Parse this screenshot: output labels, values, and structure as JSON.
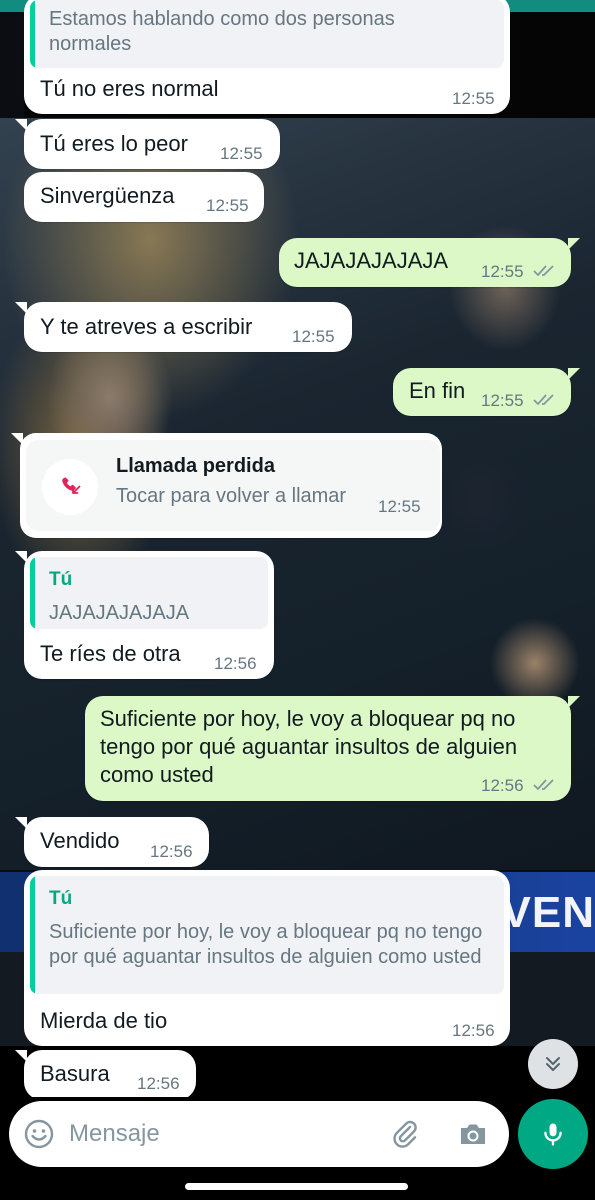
{
  "colors": {
    "incoming_bubble": "#ffffff",
    "outgoing_bubble": "#dcf8c6",
    "accent_green": "#00a884",
    "quote_bar": "#06cf9c",
    "timestamp": "#667781",
    "missed_call_red": "#e0245e"
  },
  "messages": {
    "m1": {
      "quote_text": "Estamos hablando como dos personas normales",
      "text": "Tú no eres normal",
      "time": "12:55"
    },
    "m2": {
      "text": "Tú eres lo peor",
      "time": "12:55"
    },
    "m3": {
      "text": "Sinvergüenza",
      "time": "12:55"
    },
    "m4": {
      "text": "JAJAJAJAJAJA",
      "time": "12:55",
      "read_ticks": "double-tick-icon"
    },
    "m5": {
      "text": "Y te atreves a escribir",
      "time": "12:55"
    },
    "m6": {
      "text": "En fin",
      "time": "12:55",
      "read_ticks": "double-tick-icon"
    },
    "missed_call": {
      "title": "Llamada perdida",
      "subtitle": "Tocar para volver a llamar",
      "time": "12:55",
      "icon": "missed-call-icon"
    },
    "m7": {
      "quote_author": "Tú",
      "quote_text": "JAJAJAJAJAJA",
      "text": "Te ríes de otra",
      "time": "12:56"
    },
    "m8": {
      "text": "Suficiente por hoy, le voy a bloquear pq no tengo por qué aguantar insultos de alguien como usted",
      "time": "12:56",
      "read_ticks": "double-tick-icon"
    },
    "m9": {
      "text": "Vendido",
      "time": "12:56"
    },
    "m10": {
      "quote_author": "Tú",
      "quote_text": "Suficiente por hoy, le voy a bloquear pq no tengo por qué aguantar insultos de alguien como usted",
      "text": "Mierda de tio",
      "time": "12:56"
    },
    "m11": {
      "text": "Basura",
      "time": "12:56"
    }
  },
  "wallpaper": {
    "banner_text": "VEN"
  },
  "composer": {
    "placeholder": "Mensaje",
    "emoji_icon": "emoji-icon",
    "attach_icon": "paperclip-icon",
    "camera_icon": "camera-icon",
    "mic_icon": "microphone-icon"
  },
  "scroll_down_icon": "double-chevron-down-icon"
}
